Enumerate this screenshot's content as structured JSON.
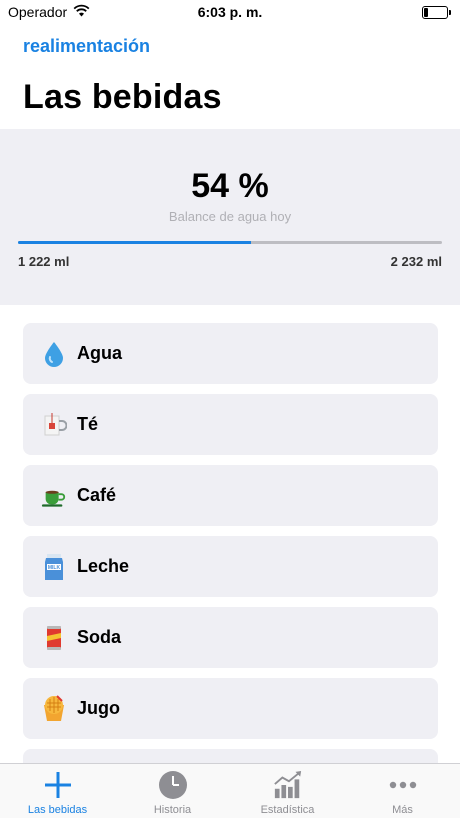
{
  "status_bar": {
    "carrier": "Operador",
    "time": "6:03 p. m."
  },
  "nav": {
    "back_label": "realimentación"
  },
  "page": {
    "title": "Las bebidas"
  },
  "balance": {
    "percent_text": "54 %",
    "caption": "Balance de agua hoy",
    "current": "1 222 ml",
    "goal": "2 232 ml",
    "progress_fraction": 0.55
  },
  "drinks": [
    {
      "label": "Agua",
      "icon": "water-drop-icon"
    },
    {
      "label": "Té",
      "icon": "tea-icon"
    },
    {
      "label": "Café",
      "icon": "coffee-cup-icon"
    },
    {
      "label": "Leche",
      "icon": "milk-carton-icon"
    },
    {
      "label": "Soda",
      "icon": "soda-can-icon"
    },
    {
      "label": "Jugo",
      "icon": "juice-icon"
    }
  ],
  "tabs": [
    {
      "label": "Las bebidas",
      "icon": "plus-icon",
      "active": true
    },
    {
      "label": "Historia",
      "icon": "clock-icon",
      "active": false
    },
    {
      "label": "Estadística",
      "icon": "chart-icon",
      "active": false
    },
    {
      "label": "Más",
      "icon": "more-icon",
      "active": false
    }
  ],
  "colors": {
    "accent": "#1a82e2",
    "panel": "#efeff4",
    "inactive": "#8e8e93"
  }
}
